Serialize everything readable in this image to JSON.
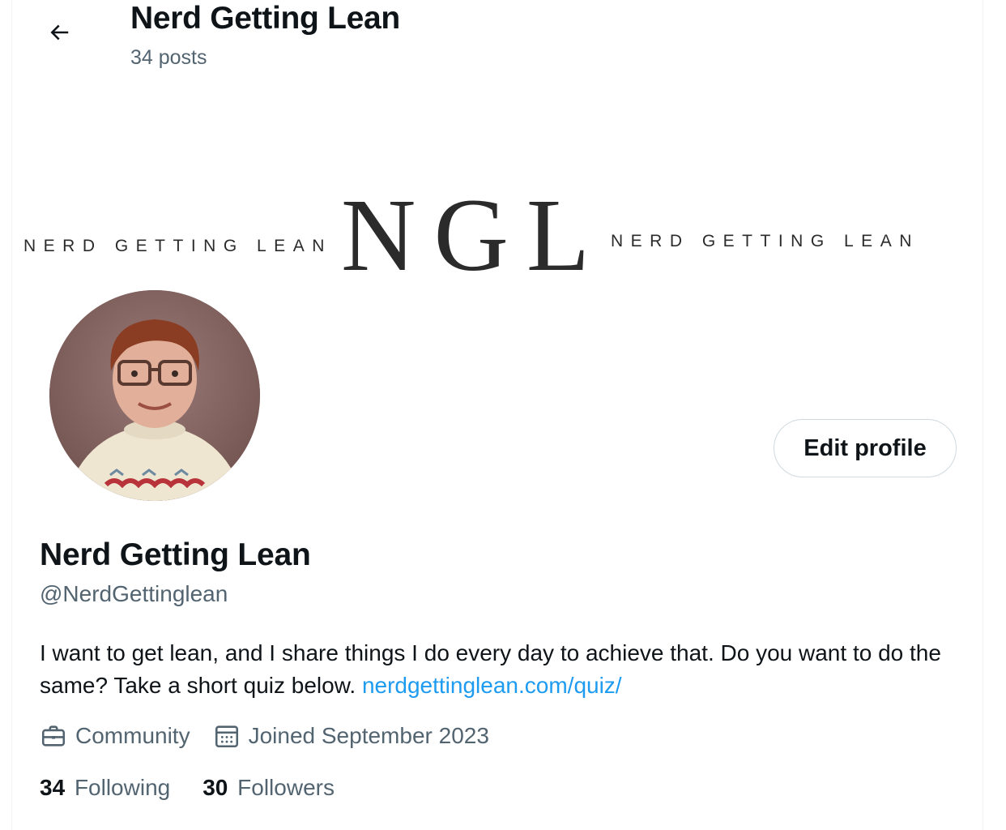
{
  "header": {
    "title": "Nerd Getting Lean",
    "post_count": "34 posts"
  },
  "banner": {
    "left_text": "NERD GETTING LEAN",
    "logo_text": "NGL",
    "right_text": "NERD GETTING LEAN"
  },
  "profile": {
    "edit_button": "Edit profile",
    "display_name": "Nerd Getting Lean",
    "handle": "@NerdGettinglean",
    "bio_text": "I want to get lean, and I share things I do every day to achieve that. Do you want to do the same? Take a short quiz below. ",
    "bio_link": "nerdgettinglean.com/quiz/",
    "category": "Community",
    "joined": "Joined September 2023",
    "following_count": "34",
    "following_label": "Following",
    "followers_count": "30",
    "followers_label": "Followers"
  },
  "colors": {
    "link": "#1d9bf0",
    "secondary_text": "#536471",
    "primary_text": "#0f1419"
  },
  "icons": {
    "back": "arrow-left-icon",
    "category": "briefcase-icon",
    "joined": "calendar-icon"
  }
}
